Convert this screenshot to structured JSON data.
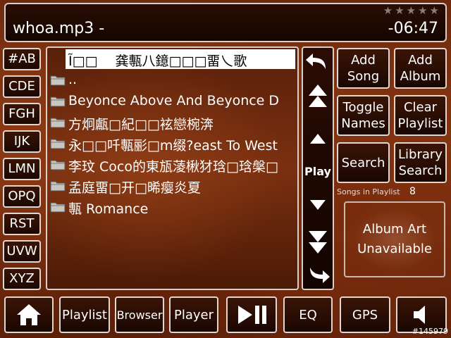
{
  "header": {
    "song_title": "whoa.mp3 -",
    "time": "-06:47",
    "rating_stars": "★★★★★"
  },
  "alphabet": [
    "#AB",
    "CDE",
    "FGH",
    "IJK",
    "LMN",
    "OPQ",
    "RST",
    "UVW",
    "XYZ"
  ],
  "browser": {
    "items": [
      {
        "name": "Ĩ□□　 龚甎八鐿□□□畱乀歌",
        "selected": true
      },
      {
        "name": ".."
      },
      {
        "name": "Beyonce  Above And Beyonce D"
      },
      {
        "name": "方炯甗□紀□□袨戀椀渀"
      },
      {
        "name": "永□□吀甎彨□m缀?east To West"
      },
      {
        "name": "李玟  Coco的東瓬蓤楸犲琀□琀槃□"
      },
      {
        "name": "孟庭畱□开□晞瘿炎夏"
      },
      {
        "name": "甎  Romance"
      }
    ]
  },
  "scroll": {
    "play_label": "Play"
  },
  "side_buttons": {
    "add_song": "Add\nSong",
    "add_album": "Add\nAlbum",
    "toggle_names": "Toggle\nNames",
    "clear_playlist": "Clear\nPlaylist",
    "search": "Search",
    "library_search": "Library\nSearch"
  },
  "playlist_info": {
    "label": "Songs in Playlist",
    "count": "8"
  },
  "album_art": {
    "text": "Album Art\nUnavailable"
  },
  "bottom_bar": {
    "playlist": "Playlist",
    "browser": "Browser",
    "player": "Player",
    "eq": "EQ",
    "gps": "GPS"
  },
  "watermark": "#145979",
  "icons": {
    "home": "home-icon",
    "play_pause": "play-pause-icon",
    "volume": "speaker-icon",
    "folder": "folder-icon",
    "back": "back-arrow-icon",
    "forward": "forward-arrow-icon"
  },
  "colors": {
    "background": "#7a2e10",
    "button_border": "#e0d8d0",
    "button_fill": "#2a0d04",
    "text": "#ffffff"
  }
}
